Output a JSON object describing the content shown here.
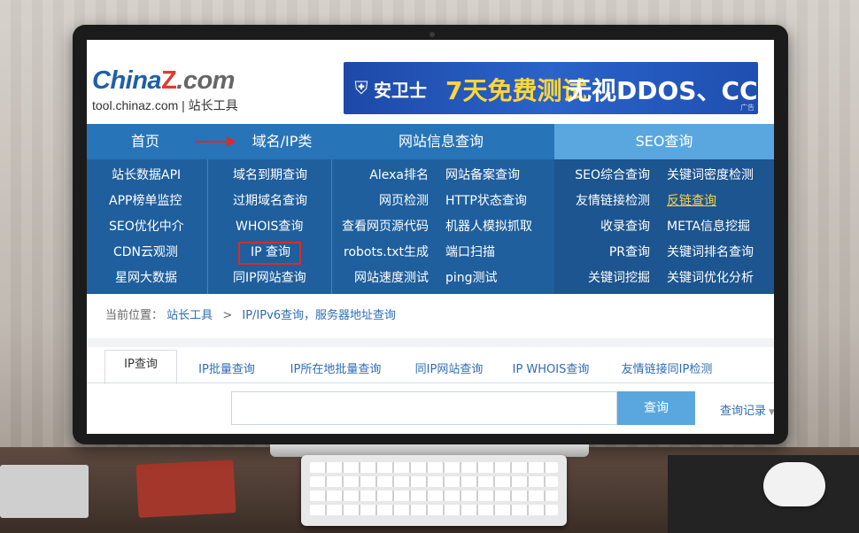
{
  "site": {
    "logo_main": "China",
    "logo_z": "Z",
    "logo_com": ".com",
    "logo_sub": "tool.chinaz.com | 站长工具"
  },
  "banner": {
    "brand": "安卫士",
    "main": "7天免费测试",
    "rest": "无视DDOS、CC",
    "ad": "广告"
  },
  "nav": {
    "home": "首页",
    "domain": "域名/IP类",
    "site_info": "网站信息查询",
    "seo": "SEO查询"
  },
  "menu": {
    "col1": [
      "站长数据API",
      "APP榜单监控",
      "SEO优化中介",
      "CDN云观测",
      "星网大数据"
    ],
    "col2": [
      "域名到期查询",
      "过期域名查询",
      "WHOIS查询",
      "IP 查询",
      "同IP网站查询"
    ],
    "col3a": [
      "Alexa排名",
      "网页检测",
      "查看网页源代码",
      "robots.txt生成",
      "网站速度测试"
    ],
    "col3b": [
      "网站备案查询",
      "HTTP状态查询",
      "机器人模拟抓取",
      "端口扫描",
      "ping测试"
    ],
    "col4a": [
      "SEO综合查询",
      "友情链接检测",
      "收录查询",
      "PR查询",
      "关键词挖掘"
    ],
    "col4b": [
      "关键词密度检测",
      "反链查询",
      "META信息挖掘",
      "关键词排名查询",
      "关键词优化分析"
    ]
  },
  "breadcrumb": {
    "label": "当前位置：",
    "root": "站长工具",
    "sep": ">",
    "current": "IP/IPv6查询，服务器地址查询"
  },
  "tabs": [
    "IP查询",
    "IP批量查询",
    "IP所在地批量查询",
    "同IP网站查询",
    "IP WHOIS查询",
    "友情链接同IP检测"
  ],
  "search": {
    "button": "查询",
    "history": "查询记录",
    "value": ""
  },
  "colors": {
    "nav": "#2874b8",
    "panel": "#1f5f9e",
    "accent": "#5aa7e0",
    "highlight_border": "#e02828"
  }
}
